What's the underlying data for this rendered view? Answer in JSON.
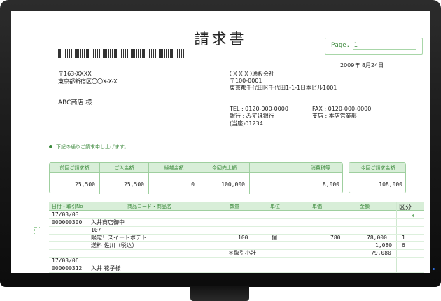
{
  "document": {
    "title": "請求書",
    "page_label": "Page. 1",
    "date": "2009年 8月24日",
    "recipient": {
      "postal": "〒163-XXXX",
      "address": "東京都新宿区〇〇X-X-X",
      "name": "ABC商店 様"
    },
    "sender": {
      "company": "〇〇〇〇通販会社",
      "postal": "〒100-0001",
      "address": "東京都千代田区千代田1-1-1日本ビル1001",
      "tel": "TEL : 0120-000-0000",
      "fax": "FAX : 0120-000-0000",
      "bank": "銀行 : みずほ銀行",
      "branch": "支店 : 本店営業部",
      "account": "(当座)01234"
    },
    "note": "下記の通りご請求申し上げます。"
  },
  "summary": {
    "headers": [
      "前回ご請求額",
      "ご入金額",
      "繰越金額",
      "今回売上額",
      "",
      "消費税等",
      "今回ご請求金額"
    ],
    "values": [
      "25,500",
      "25,500",
      "0",
      "100,000",
      "",
      "8,000",
      "108,000"
    ]
  },
  "table": {
    "headers": {
      "date": "日付・取引No",
      "product": "商品コード・商品名",
      "qty": "数量",
      "unit": "単位",
      "price": "単価",
      "amount": "金額",
      "category": "区分"
    },
    "rows": {
      "r1_date": "17/03/03",
      "r1_no": "000000300",
      "r1_name": "入井商店御中",
      "r1_code": "107",
      "r1_product": "限定！スイートポテト",
      "r1_qty": "100",
      "r1_unit": "個",
      "r1_price": "780",
      "r1_amount": "78,000",
      "r1_cat": "1",
      "r2_product": "送料 佐川（税込）",
      "r2_amount": "1,080",
      "r2_cat": "6",
      "sub_label": "＊取引小計",
      "sub_amount": "79,080",
      "r3_date": "17/03/06",
      "r3_no": "000000312",
      "r3_name": "入井 花子様"
    }
  },
  "colors": {
    "accent_green": "#3d8a3d",
    "header_fill": "#d8eed8",
    "bezel": "#161616",
    "power_led": "#2f6fe0"
  }
}
